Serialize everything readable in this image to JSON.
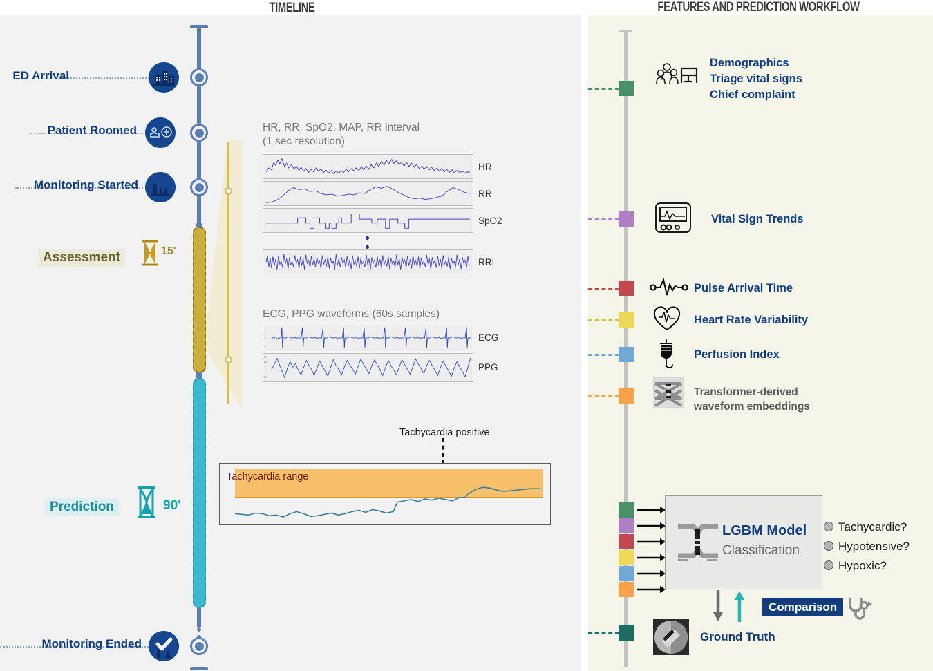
{
  "panels": {
    "timeline_title": "TIMELINE",
    "features_title": "FEATURES AND PREDICTION WORKFLOW"
  },
  "timeline": {
    "milestones": [
      {
        "label": "ED Arrival",
        "icon": "hospital-building-icon"
      },
      {
        "label": "Patient Roomed",
        "icon": "patient-bed-icon"
      },
      {
        "label": "Monitoring Started",
        "icon": "monitor-equipment-icon"
      },
      {
        "label": "Monitoring Ended",
        "icon": "check-circle-icon"
      }
    ],
    "phases": [
      {
        "name": "Assessment",
        "duration": "15'",
        "color": "#a08a33",
        "chip_bg": "#eceadb"
      },
      {
        "name": "Prediction",
        "duration": "90'",
        "color": "#13a3ae",
        "chip_bg": "#dcf0f2"
      }
    ]
  },
  "vitals_panel": {
    "heading_grey": "HR, RR, SpO2, MAP, RR interval",
    "heading_dark": "(1 sec resolution)",
    "traces": [
      "HR",
      "RR",
      "SpO2",
      "RRI"
    ]
  },
  "waveform_panel": {
    "heading_grey": "ECG, PPG waveforms",
    "heading_dark": "(60s samples)",
    "traces": [
      "ECG",
      "PPG"
    ],
    "ecg_yticks": [
      "1",
      "0",
      "-1"
    ],
    "ppg_yticks": [
      "500",
      "500",
      "0",
      "-500"
    ]
  },
  "tachy_chart": {
    "annotation": "Tachycardia positive",
    "band_label": "Tachycardia range",
    "band_color": "#f8c06a"
  },
  "features": [
    {
      "labels": [
        "Demographics",
        "Triage vital signs",
        "Chief complaint"
      ],
      "color": "#4a9167",
      "icon": "people-stretcher-icon",
      "style": "blue"
    },
    {
      "labels": [
        "Vital Sign Trends"
      ],
      "color": "#b07ec4",
      "icon": "vital-monitor-icon",
      "style": "blue"
    },
    {
      "labels": [
        "Pulse Arrival Time"
      ],
      "color": "#c2474f",
      "icon": "pulse-wave-icon",
      "style": "blue"
    },
    {
      "labels": [
        "Heart Rate Variability"
      ],
      "color": "#eed857",
      "icon": "heart-pulse-icon",
      "style": "blue"
    },
    {
      "labels": [
        "Perfusion Index"
      ],
      "color": "#71a8d6",
      "icon": "iv-drip-icon",
      "style": "blue"
    },
    {
      "labels": [
        "Transformer-derived",
        "waveform embeddings"
      ],
      "color": "#f9a24b",
      "icon": "transformer-network-icon",
      "style": "grey"
    }
  ],
  "model": {
    "name": "LGBM Model",
    "subtitle": "Classification",
    "icon": "model-glyph-icon",
    "outputs": [
      "Tachycardic?",
      "Hypotensive?",
      "Hypoxic?"
    ],
    "comparison_label": "Comparison",
    "ground_truth_label": "Ground Truth",
    "ground_truth_color": "#1d6b63"
  }
}
